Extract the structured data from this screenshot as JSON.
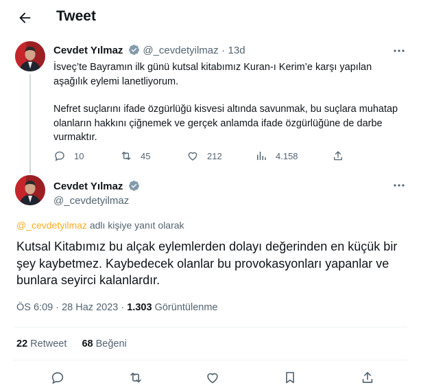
{
  "header": {
    "title": "Tweet",
    "back_icon": "arrow-left-icon"
  },
  "colors": {
    "text": "#0f1419",
    "muted": "#536471",
    "verified": "#829aab",
    "mention": "#ffad1f",
    "divider": "#eff3f4"
  },
  "tweet1": {
    "name": "Cevdet Yılmaz",
    "handle": "@_cevdetyilmaz",
    "separator": "·",
    "time": "13d",
    "paragraph1": "İsveç’te Bayramın ilk günü kutsal kitabımız Kuran-ı Kerim’e karşı yapılan aşağılık eylemi lanetliyorum.",
    "paragraph2": "Nefret suçlarını ifade özgürlüğü kisvesi altında savunmak, bu suçlara muhatap olanların hakkını çiğnemek ve gerçek anlamda ifade özgürlüğüne de darbe vurmaktır.",
    "actions": {
      "replies": "10",
      "retweets": "45",
      "likes": "212",
      "views": "4.158"
    }
  },
  "tweet2": {
    "name": "Cevdet Yılmaz",
    "handle": "@_cevdetyilmaz",
    "reply_to_handle": "@_cevdetyilmaz",
    "reply_to_suffix": "adlı kişiye yanıt olarak",
    "body": "Kutsal Kitabımız bu alçak eylemlerden dolayı değerinden en küçük bir şey kaybetmez. Kaybedecek olanlar bu provokasyonları yapanlar ve bunlara seyirci kalanlardır.",
    "time": "ÖS 6:09",
    "date": "28 Haz 2023",
    "views_count": "1.303",
    "views_label": "Görüntülenme",
    "dot": "·",
    "retweet_count": "22",
    "retweet_label": "Retweet",
    "like_count": "68",
    "like_label": "Beğeni"
  }
}
